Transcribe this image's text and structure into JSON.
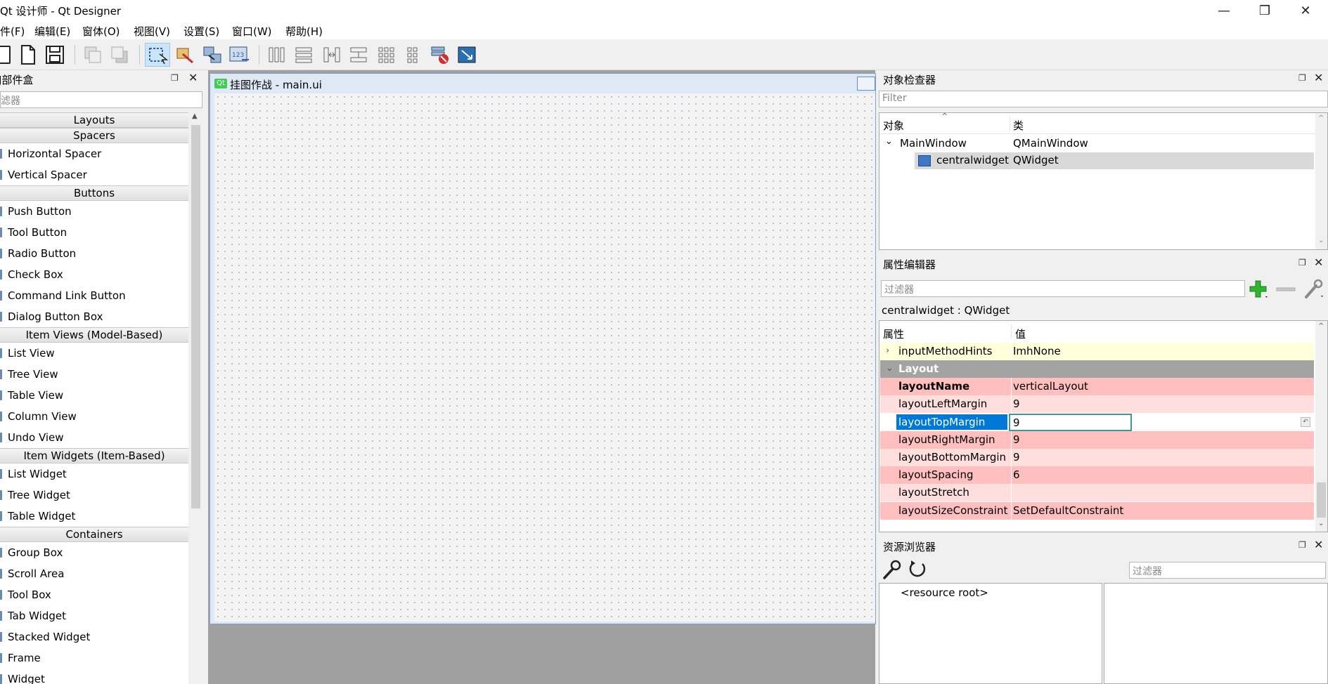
{
  "window": {
    "title": "Qt 设计师 - Qt Designer",
    "minimize": "—",
    "restore": "❐",
    "close": "✕"
  },
  "menubar": [
    "件(F)",
    "编辑(E)",
    "窗体(O)",
    "视图(V)",
    "设置(S)",
    "窗口(W)",
    "帮助(H)"
  ],
  "widget_box": {
    "title": "J部件盒",
    "filter_placeholder": "滤器",
    "rows": [
      {
        "type": "cat",
        "label": "Layouts"
      },
      {
        "type": "cat",
        "label": "Spacers"
      },
      {
        "type": "item",
        "label": "Horizontal Spacer"
      },
      {
        "type": "item",
        "label": "Vertical Spacer"
      },
      {
        "type": "cat",
        "label": "Buttons"
      },
      {
        "type": "item",
        "label": "Push Button"
      },
      {
        "type": "item",
        "label": "Tool Button"
      },
      {
        "type": "item",
        "label": "Radio Button"
      },
      {
        "type": "item",
        "label": "Check Box"
      },
      {
        "type": "item",
        "label": "Command Link Button"
      },
      {
        "type": "item",
        "label": "Dialog Button Box"
      },
      {
        "type": "cat",
        "label": "Item Views (Model-Based)"
      },
      {
        "type": "item",
        "label": "List View"
      },
      {
        "type": "item",
        "label": "Tree View"
      },
      {
        "type": "item",
        "label": "Table View"
      },
      {
        "type": "item",
        "label": "Column View"
      },
      {
        "type": "item",
        "label": "Undo View"
      },
      {
        "type": "cat",
        "label": "Item Widgets (Item-Based)"
      },
      {
        "type": "item",
        "label": "List Widget"
      },
      {
        "type": "item",
        "label": "Tree Widget"
      },
      {
        "type": "item",
        "label": "Table Widget"
      },
      {
        "type": "cat",
        "label": "Containers"
      },
      {
        "type": "item",
        "label": "Group Box"
      },
      {
        "type": "item",
        "label": "Scroll Area"
      },
      {
        "type": "item",
        "label": "Tool Box"
      },
      {
        "type": "item",
        "label": "Tab Widget"
      },
      {
        "type": "item",
        "label": "Stacked Widget"
      },
      {
        "type": "item",
        "label": "Frame"
      },
      {
        "type": "item",
        "label": "Widget"
      }
    ]
  },
  "form_window": {
    "icon_text": "Qt",
    "title": "挂图作战 - main.ui"
  },
  "object_inspector": {
    "title": "对象检查器",
    "filter_placeholder": "Filter",
    "col_object": "对象",
    "col_class": "类",
    "rows": [
      {
        "object": "MainWindow",
        "class": "QMainWindow"
      },
      {
        "object": "centralwidget",
        "class": "QWidget"
      }
    ]
  },
  "property_editor": {
    "title": "属性编辑器",
    "filter_placeholder": "过滤器",
    "subject": "centralwidget : QWidget",
    "col_property": "属性",
    "col_value": "值",
    "rows": [
      {
        "name": "inputMethodHints",
        "value": "ImhNone",
        "style": "yellow",
        "expand": "›"
      },
      {
        "name": "Layout",
        "value": "",
        "style": "group",
        "expand": "⌄"
      },
      {
        "name": "layoutName",
        "value": "verticalLayout",
        "style": "pink-dark",
        "bold": true
      },
      {
        "name": "layoutLeftMargin",
        "value": "9",
        "style": "pink-light"
      },
      {
        "name": "layoutTopMargin",
        "value": "9",
        "style": "selected"
      },
      {
        "name": "layoutRightMargin",
        "value": "9",
        "style": "pink-dark"
      },
      {
        "name": "layoutBottomMargin",
        "value": "9",
        "style": "pink-light"
      },
      {
        "name": "layoutSpacing",
        "value": "6",
        "style": "pink-dark"
      },
      {
        "name": "layoutStretch",
        "value": "",
        "style": "pink-light"
      },
      {
        "name": "layoutSizeConstraint",
        "value": "SetDefaultConstraint",
        "style": "pink-dark"
      }
    ]
  },
  "resource_browser": {
    "title": "资源浏览器",
    "filter_placeholder": "过滤器",
    "root": "<resource root>"
  },
  "colors": {
    "pink_dark": "#ffbfbf",
    "pink_light": "#ffdede",
    "yellow": "#ffffdc",
    "group": "#a3a3a3",
    "selection": "#0078d7"
  }
}
